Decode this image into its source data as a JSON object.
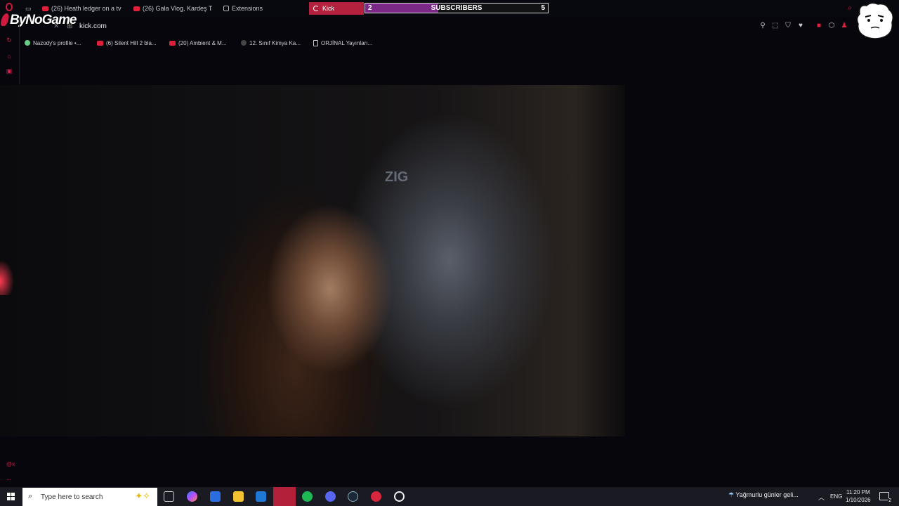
{
  "tabs": [
    {
      "label": "(26) Heath ledger on a tv"
    },
    {
      "label": "(26) Gala Vlog, Kardeş Ta"
    },
    {
      "label": "Extensions"
    }
  ],
  "active_tab": {
    "label": "Kick"
  },
  "overlay": {
    "logo_text": "ByNoGame",
    "subs_current": "2",
    "subs_label": "SUBSCRIBERS",
    "subs_goal": "5",
    "subs_progress": 0.4
  },
  "address_bar": {
    "url": "kick.com"
  },
  "bookmarks": [
    {
      "label": "Nazody's profile •..."
    },
    {
      "label": "(6) Silent Hill 2 bla..."
    },
    {
      "label": "(20) Ambient & M..."
    },
    {
      "label": "12. Sınıf Kimya Ka..."
    },
    {
      "label": "ORJİNAL Yayınları..."
    }
  ],
  "video": {
    "chair_logo": "ZIG"
  },
  "left_rail": {
    "bottom_label_1": "@x",
    "bottom_label_2": "..."
  },
  "taskbar": {
    "search_placeholder": "Type here to search",
    "weather": "Yağmurlu günler geli...",
    "lang": "ENG",
    "time": "11:20 PM",
    "date": "1/10/2026",
    "notifications": "2"
  },
  "colors": {
    "accent": "#b3213f",
    "subs_fill": "#7a2a86",
    "taskbar": "#191a22"
  }
}
